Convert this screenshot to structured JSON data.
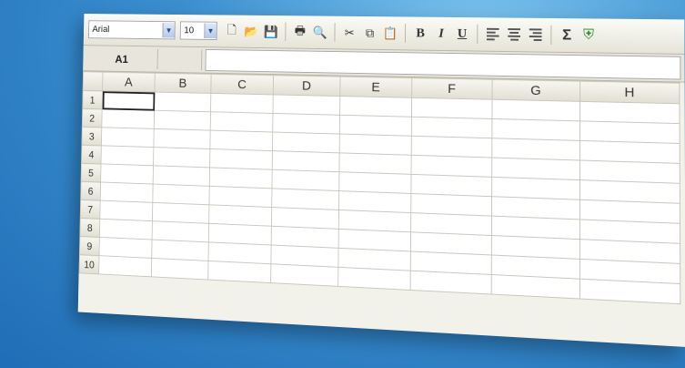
{
  "toolbar": {
    "font_name": "Arial",
    "font_size": "10",
    "bold_label": "B",
    "italic_label": "I",
    "underline_label": "U",
    "sum_label": "Σ"
  },
  "formula_bar": {
    "name_box": "A1",
    "formula_value": ""
  },
  "grid": {
    "columns": [
      "A",
      "B",
      "C",
      "D",
      "E",
      "F",
      "G",
      "H"
    ],
    "rows": [
      "1",
      "2",
      "3",
      "4",
      "5",
      "6",
      "7",
      "8",
      "9",
      "10"
    ],
    "active_cell": "A1"
  }
}
